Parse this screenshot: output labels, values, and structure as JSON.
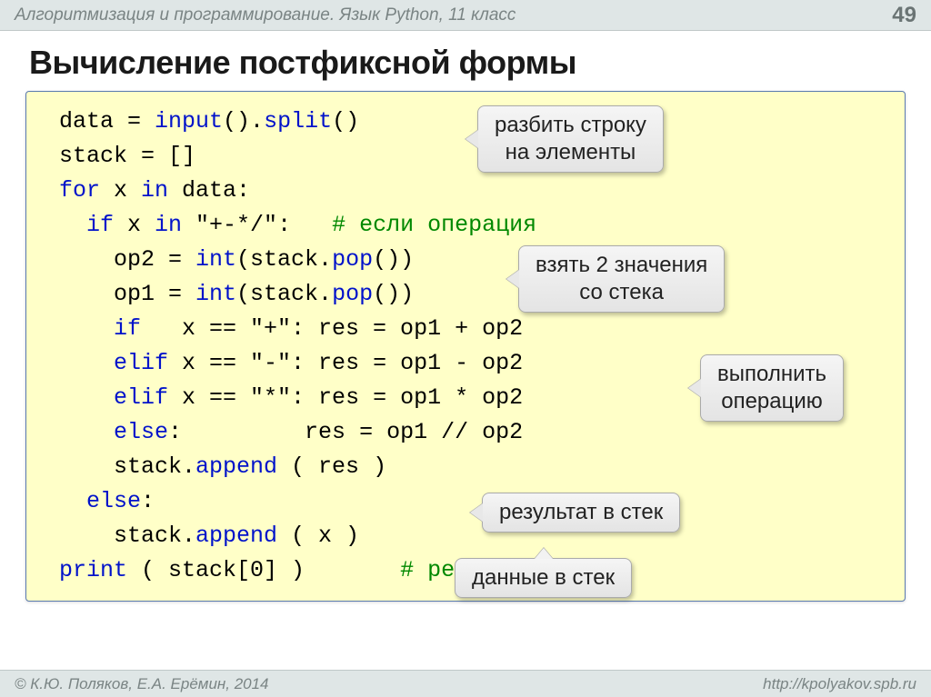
{
  "header": {
    "title": "Алгоритмизация и программирование. Язык Python, 11 класс",
    "page_number": "49"
  },
  "title": "Вычисление постфиксной формы",
  "code": {
    "l1_a": "data = ",
    "l1_b": "input",
    "l1_c": "().",
    "l1_d": "split",
    "l1_e": "()",
    "l2": "stack = []",
    "l3_a": "for",
    "l3_b": " x ",
    "l3_c": "in",
    "l3_d": " data:",
    "l4_a": "  if",
    "l4_b": " x ",
    "l4_c": "in",
    "l4_d": " \"+-*/\":   ",
    "l4_e": "# если операция",
    "l5_a": "    op2 = ",
    "l5_b": "int",
    "l5_c": "(stack.",
    "l5_d": "pop",
    "l5_e": "())",
    "l6_a": "    op1 = ",
    "l6_b": "int",
    "l6_c": "(stack.",
    "l6_d": "pop",
    "l6_e": "())",
    "l7_a": "    if",
    "l7_b": "   x == \"+\": res = op1 + op2",
    "l8_a": "    elif",
    "l8_b": " x == \"-\": res = op1 - op2",
    "l9_a": "    elif",
    "l9_b": " x == \"*\": res = op1 * op2",
    "l10_a": "    else",
    "l10_b": ":         res = op1 // op2",
    "l11_a": "    stack.",
    "l11_b": "append",
    "l11_c": " ( res )",
    "l12_a": "  else",
    "l12_b": ":",
    "l13_a": "    stack.",
    "l13_b": "append",
    "l13_c": " ( x )",
    "l14_a": "print",
    "l14_b": " ( stack[0] )       ",
    "l14_c": "# результат"
  },
  "callouts": {
    "c1_l1": "разбить строку",
    "c1_l2": "на элементы",
    "c2_l1": "взять 2 значения",
    "c2_l2": "со стека",
    "c3_l1": "выполнить",
    "c3_l2": "операцию",
    "c4": "результат в стек",
    "c5": "данные в стек"
  },
  "footer": {
    "left": "© К.Ю. Поляков, Е.А. Ерёмин, 2014",
    "right": "http://kpolyakov.spb.ru"
  }
}
